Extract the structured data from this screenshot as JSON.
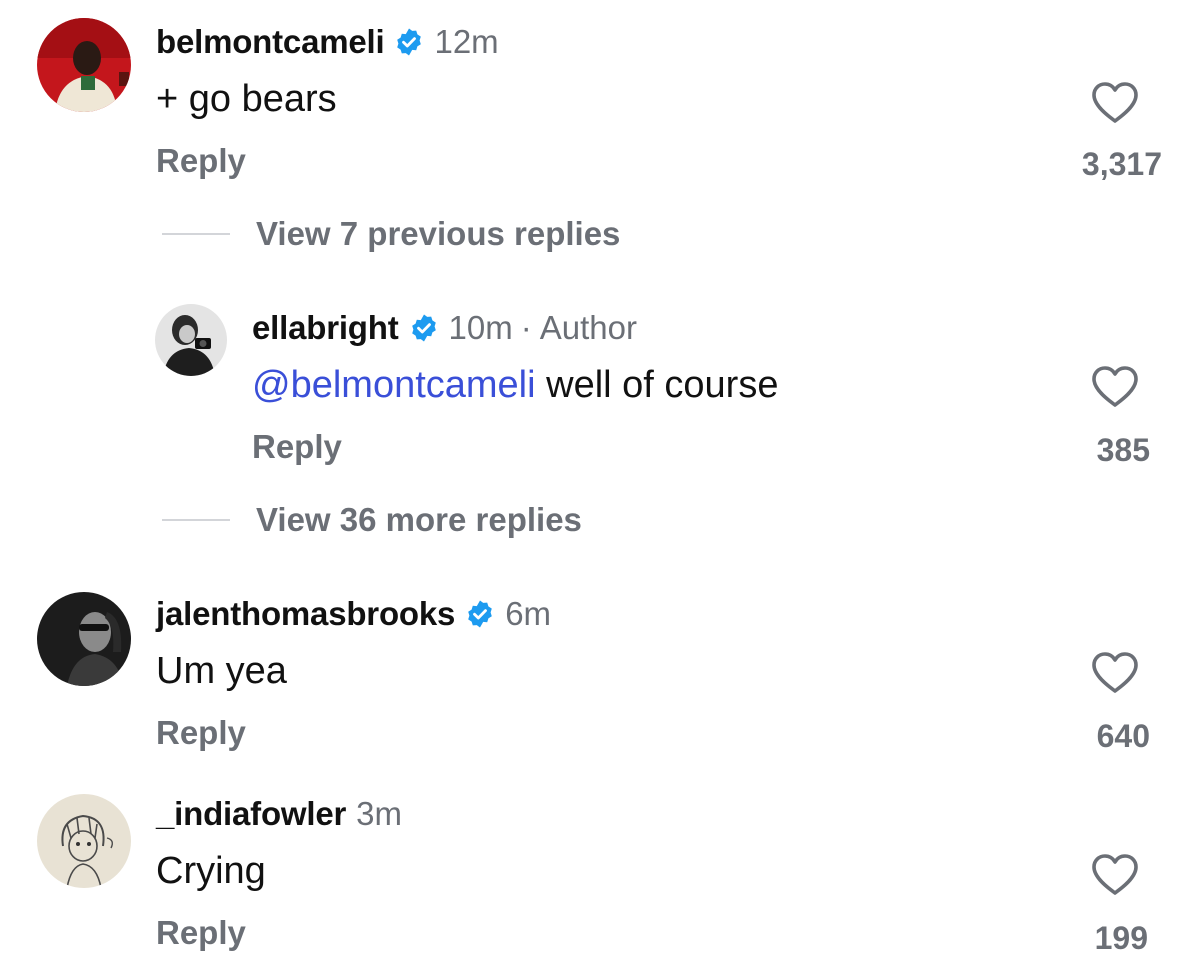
{
  "comments": [
    {
      "username": "belmontcameli",
      "verified": true,
      "time": "12m",
      "text": "+ go bears",
      "reply_label": "Reply",
      "likes": "3,317",
      "avatar_icon": "profile-photo-red-background"
    },
    {
      "username": "jalenthomasbrooks",
      "verified": true,
      "time": "6m",
      "text": "Um yea",
      "reply_label": "Reply",
      "likes": "640",
      "avatar_icon": "profile-photo-bw-sunglasses"
    },
    {
      "username": "_indiafowler",
      "verified": false,
      "time": "3m",
      "text": "Crying",
      "reply_label": "Reply",
      "likes": "199",
      "avatar_icon": "profile-photo-anime-sketch"
    }
  ],
  "thread": {
    "view_previous": "View 7 previous replies",
    "view_more": "View 36 more replies",
    "reply": {
      "username": "ellabright",
      "verified": true,
      "time": "10m",
      "separator": "·",
      "author_tag": "Author",
      "mention": "@belmontcameli",
      "text": " well of course",
      "reply_label": "Reply",
      "likes": "385",
      "avatar_icon": "profile-photo-bw-camera"
    }
  },
  "colors": {
    "verified": "#1d9bf0",
    "mention": "#3a4fd8",
    "muted": "#6b6f76"
  }
}
